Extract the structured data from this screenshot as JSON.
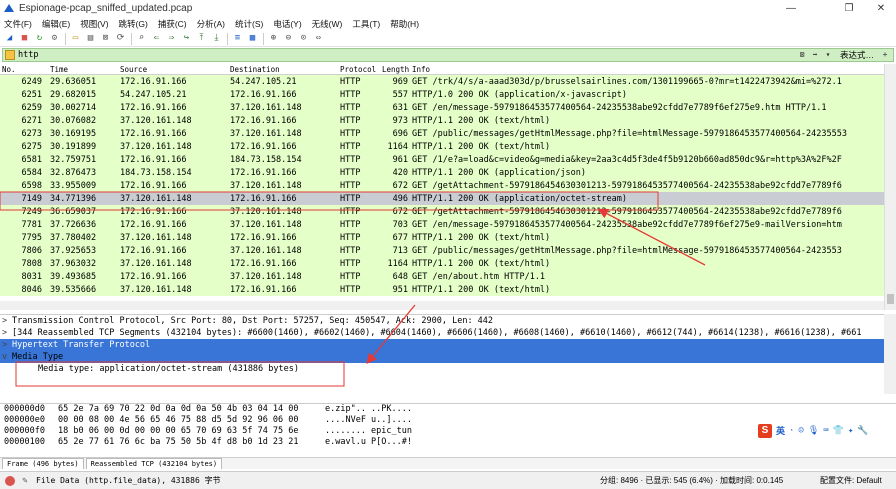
{
  "window": {
    "title": "Espionage-pcap_sniffed_updated.pcap",
    "minimize_glyph": "—",
    "restore_glyph": "❐",
    "close_glyph": "✕"
  },
  "menu": [
    "文件(F)",
    "编辑(E)",
    "视图(V)",
    "跳转(G)",
    "捕获(C)",
    "分析(A)",
    "统计(S)",
    "电话(Y)",
    "无线(W)",
    "工具(T)",
    "帮助(H)"
  ],
  "toolbar_icons": [
    "shark-fin-icon",
    "stop-icon",
    "restart-icon",
    "options-gear-icon",
    "open-file-icon",
    "save-icon",
    "close-file-icon",
    "reload-icon",
    "find-icon",
    "back-icon",
    "forward-icon",
    "goto-icon",
    "first-icon",
    "last-icon",
    "autoscroll-icon",
    "colorize-icon",
    "zoom-in-icon",
    "zoom-out-icon",
    "zoom-normal-icon",
    "resize-columns-icon"
  ],
  "filter": {
    "value": "http",
    "expression_label": "表达式…",
    "plus": "+"
  },
  "columns": [
    "No.",
    "Time",
    "Source",
    "Destination",
    "Protocol",
    "Length",
    "Info"
  ],
  "packets": [
    {
      "no": "6249",
      "time": "29.636051",
      "src": "172.16.91.166",
      "dst": "54.247.105.21",
      "proto": "HTTP",
      "len": "969",
      "info": "GET /trk/4/s/a-aaad303d/p/brusselsairlines.com/1301199665-0?mr=t1422473942&mi=%272.1"
    },
    {
      "no": "6251",
      "time": "29.682015",
      "src": "54.247.105.21",
      "dst": "172.16.91.166",
      "proto": "HTTP",
      "len": "557",
      "info": "HTTP/1.0 200 OK  (application/x-javascript)"
    },
    {
      "no": "6259",
      "time": "30.002714",
      "src": "172.16.91.166",
      "dst": "37.120.161.148",
      "proto": "HTTP",
      "len": "631",
      "info": "GET /en/message-597918645357740056​4-24235538abe92cfdd7e7789f6ef275e9.htm HTTP/1.1"
    },
    {
      "no": "6271",
      "time": "30.076082",
      "src": "37.120.161.148",
      "dst": "172.16.91.166",
      "proto": "HTTP",
      "len": "973",
      "info": "HTTP/1.1 200 OK  (text/html)"
    },
    {
      "no": "6273",
      "time": "30.169195",
      "src": "172.16.91.166",
      "dst": "37.120.161.148",
      "proto": "HTTP",
      "len": "696",
      "info": "GET /public/messages/getHtmlMessage.php?file=htmlMessage-5979186453577400564-24235553"
    },
    {
      "no": "6275",
      "time": "30.191899",
      "src": "37.120.161.148",
      "dst": "172.16.91.166",
      "proto": "HTTP",
      "len": "1164",
      "info": "HTTP/1.1 200 OK  (text/html)"
    },
    {
      "no": "6581",
      "time": "32.759751",
      "src": "172.16.91.166",
      "dst": "184.73.158.154",
      "proto": "HTTP",
      "len": "961",
      "info": "GET /1/e?a=load&c=video&g=media&key=2aa3c4d5f3de4f5b9120b660ad850dc9&r=http%3A%2F%2F"
    },
    {
      "no": "6584",
      "time": "32.876473",
      "src": "184.73.158.154",
      "dst": "172.16.91.166",
      "proto": "HTTP",
      "len": "420",
      "info": "HTTP/1.1 200 OK  (application/json)"
    },
    {
      "no": "6598",
      "time": "33.955009",
      "src": "172.16.91.166",
      "dst": "37.120.161.148",
      "proto": "HTTP",
      "len": "672",
      "info": "GET /getAttachment-5979186454630301213-5979186453577400564-24235538abe92cfdd7e7789f6"
    },
    {
      "no": "7149",
      "time": "34.771396",
      "src": "37.120.161.148",
      "dst": "172.16.91.166",
      "proto": "HTTP",
      "len": "496",
      "info": "HTTP/1.1 200 OK  (application/octet-stream)",
      "selected": true
    },
    {
      "no": "7249",
      "time": "36.659037",
      "src": "172.16.91.166",
      "dst": "37.120.161.148",
      "proto": "HTTP",
      "len": "672",
      "info": "GET /getAttachment-5979186454630301213-5979186453577400564-24235538abe92cfdd7e7789f6"
    },
    {
      "no": "7781",
      "time": "37.726636",
      "src": "172.16.91.166",
      "dst": "37.120.161.148",
      "proto": "HTTP",
      "len": "703",
      "info": "GET /en/message-5979186453577400564-24235538abe92cfdd7e7789f6ef275e9-mailVersion=htm"
    },
    {
      "no": "7795",
      "time": "37.780402",
      "src": "37.120.161.148",
      "dst": "172.16.91.166",
      "proto": "HTTP",
      "len": "677",
      "info": "HTTP/1.1 200 OK  (text/html)"
    },
    {
      "no": "7806",
      "time": "37.925653",
      "src": "172.16.91.166",
      "dst": "37.120.161.148",
      "proto": "HTTP",
      "len": "713",
      "info": "GET /public/messages/getHtmlMessage.php?file=htmlMessage-5979186453577400564-2423553"
    },
    {
      "no": "7808",
      "time": "37.963032",
      "src": "37.120.161.148",
      "dst": "172.16.91.166",
      "proto": "HTTP",
      "len": "1164",
      "info": "HTTP/1.1 200 OK  (text/html)"
    },
    {
      "no": "8031",
      "time": "39.493685",
      "src": "172.16.91.166",
      "dst": "37.120.161.148",
      "proto": "HTTP",
      "len": "648",
      "info": "GET /en/about.htm HTTP/1.1"
    },
    {
      "no": "8046",
      "time": "39.535666",
      "src": "37.120.161.148",
      "dst": "172.16.91.166",
      "proto": "HTTP",
      "len": "951",
      "info": "HTTP/1.1 200 OK  (text/html)"
    }
  ],
  "details": [
    {
      "twisty": ">",
      "text": "Transmission Control Protocol, Src Port: 80, Dst Port: 57257, Seq: 450547, Ack: 2900, Len: 442"
    },
    {
      "twisty": ">",
      "text": "[344 Reassembled TCP Segments (432104 bytes): #6600(1460), #6602(1460), #6604(1460), #6606(1460), #6608(1460), #6610(1460), #6612(744), #6614(1238), #6616(1238), #661"
    },
    {
      "twisty": ">",
      "text": "Hypertext Transfer Protocol",
      "style": "sel"
    },
    {
      "twisty": "v",
      "text": "Media Type",
      "style": "media"
    },
    {
      "twisty": "",
      "text": "Media type: application/octet-stream (431886 bytes)",
      "style": "child"
    }
  ],
  "bytes": [
    {
      "off": "000000d0",
      "hex": "65 2e 7a 69 70 22 0d 0a  0d 0a 50 4b 03 04 14 00",
      "ascii": "e.zip\"..  ..PK...."
    },
    {
      "off": "000000e0",
      "hex": "00 00 08 00 4e 56 65 46  75 88 d5 5d 92 96 06 00",
      "ascii": "....NVeF u..]...."
    },
    {
      "off": "000000f0",
      "hex": "18 b0 06 00 0d 00 00 00  65 70 69 63 5f 74 75 6e",
      "ascii": "........ epic_tun"
    },
    {
      "off": "00000100",
      "hex": "65 2e 77 61 76 6c ba 75  50 5b 4f d8 b0 1d 23 21",
      "ascii": "e.wavl.u P[O...#!"
    }
  ],
  "byte_tabs": [
    "Frame (496 bytes)",
    "Reassembled TCP (432104 bytes)"
  ],
  "status": {
    "left": "File Data (http.file_data), 431886 字节",
    "packets": "分组: 8496 · 已显示: 545 (6.4%) · 加载时间: 0:0.145",
    "profile": "配置文件: Default"
  },
  "ime": {
    "logo": "S",
    "lang": "英",
    "icons": [
      "·",
      "☺",
      "🎙",
      "⌨",
      "👕",
      "✦",
      "🔧"
    ]
  },
  "colors": {
    "row_green": "#e4ffc7",
    "row_selected": "#c9cdd3",
    "detail_selected": "#3875d7",
    "annotation_red": "#e53935",
    "filter_bg": "#cfeec4"
  }
}
